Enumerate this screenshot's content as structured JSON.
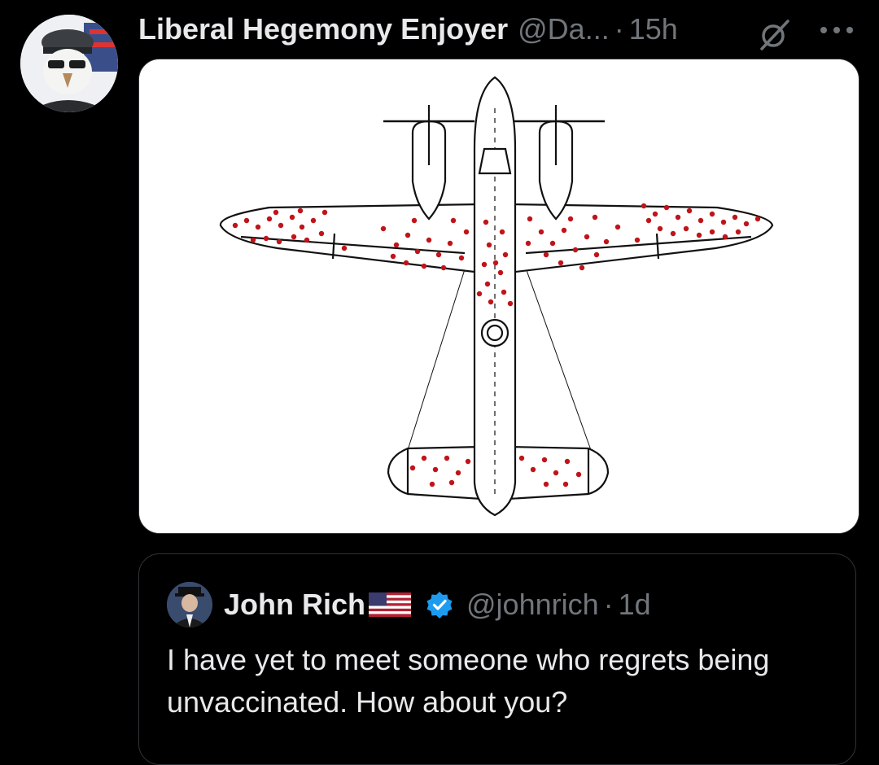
{
  "tweet": {
    "display_name": "Liberal Hegemony Enjoyer",
    "handle": "@Da...",
    "separator": "·",
    "time": "15h",
    "media_description_icon": "airplane-bullet-holes-illustration"
  },
  "quoted_tweet": {
    "display_name": "John Rich",
    "flag_icon": "us-flag-icon",
    "verified_icon": "verified-badge-icon",
    "handle": "@johnrich",
    "separator": "·",
    "time": "1d",
    "text": "I have yet to meet someone who regrets being unvaccinated. How about you?"
  },
  "colors": {
    "background": "#000000",
    "text_primary": "#e7e9ea",
    "text_secondary": "#71767b",
    "verified_blue": "#1d9bf0",
    "bullet_hole_red": "#c0141a"
  }
}
